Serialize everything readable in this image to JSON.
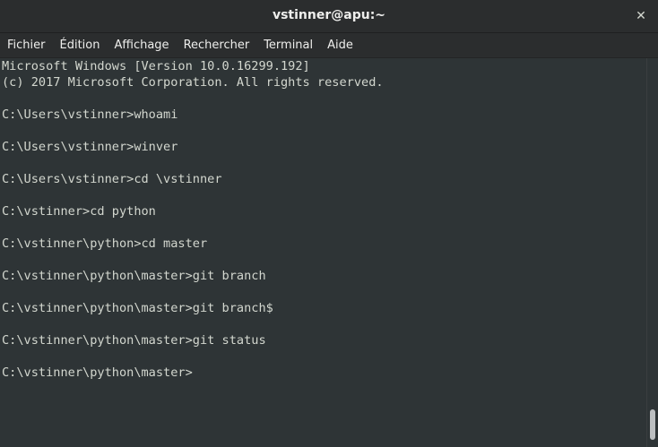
{
  "window": {
    "title": "vstinner@apu:~",
    "close_label": "✕"
  },
  "menu": [
    {
      "label": "Fichier"
    },
    {
      "label": "Édition"
    },
    {
      "label": "Affichage"
    },
    {
      "label": "Rechercher"
    },
    {
      "label": "Terminal"
    },
    {
      "label": "Aide"
    }
  ],
  "terminal": {
    "lines": [
      "Microsoft Windows [Version 10.0.16299.192]",
      "(c) 2017 Microsoft Corporation. All rights reserved.",
      "",
      "C:\\Users\\vstinner>whoami",
      "",
      "C:\\Users\\vstinner>winver",
      "",
      "C:\\Users\\vstinner>cd \\vstinner",
      "",
      "C:\\vstinner>cd python",
      "",
      "C:\\vstinner\\python>cd master",
      "",
      "C:\\vstinner\\python\\master>git branch",
      "",
      "C:\\vstinner\\python\\master>git branch$",
      "",
      "C:\\vstinner\\python\\master>git status",
      "",
      "C:\\vstinner\\python\\master>"
    ]
  }
}
